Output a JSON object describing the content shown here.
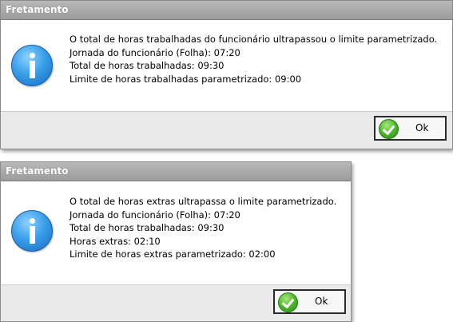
{
  "dialogs": [
    {
      "title": "Fretamento",
      "lines": [
        "O total de horas trabalhadas do funcionário ultrapassou o limite parametrizado.",
        "Jornada do funcionário (Folha): 07:20",
        "Total de horas trabalhadas: 09:30",
        "Limite de horas trabalhadas parametrizado: 09:00"
      ],
      "ok_label": "Ok",
      "icon": "info-icon"
    },
    {
      "title": "Fretamento",
      "lines": [
        "O total de horas extras ultrapassa o limite parametrizado.",
        "Jornada do funcionário (Folha): 07:20",
        "Total de horas trabalhadas: 09:30",
        "Horas extras: 02:10",
        "Limite de horas extras parametrizado: 02:00"
      ],
      "ok_label": "Ok",
      "icon": "info-icon"
    }
  ]
}
